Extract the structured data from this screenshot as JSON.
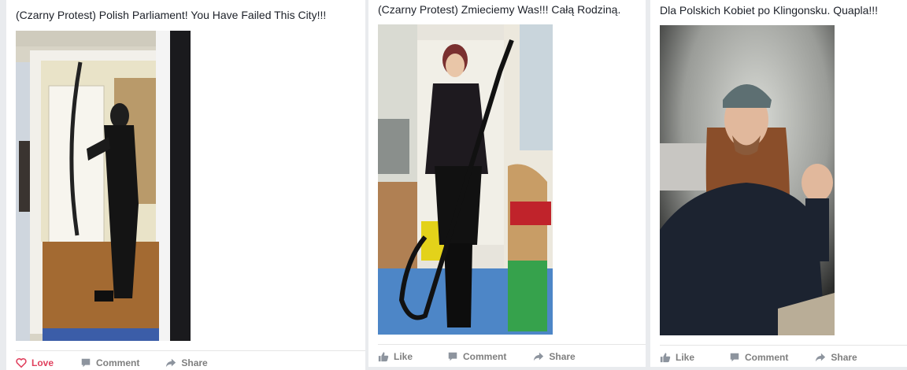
{
  "posts": [
    {
      "caption": "(Czarny Protest) Polish Parliament! You Have Failed This City!!!",
      "actions": {
        "love": "Love",
        "comment": "Comment",
        "share": "Share"
      }
    },
    {
      "caption": "(Czarny Protest) Zmieciemy Was!!! Całą Rodziną.",
      "actions": {
        "like": "Like",
        "comment": "Comment",
        "share": "Share"
      }
    },
    {
      "caption": "Dla Polskich Kobiet po Klingonsku. Quapla!!!",
      "actions": {
        "like": "Like",
        "comment": "Comment",
        "share": "Share"
      }
    }
  ],
  "colors": {
    "love": "#e0405d",
    "action_gray": "#7f7f7f",
    "text": "#1d2129",
    "background": "#e9ebee"
  },
  "icons": [
    "heart-icon",
    "like-icon",
    "comment-icon",
    "share-icon"
  ]
}
